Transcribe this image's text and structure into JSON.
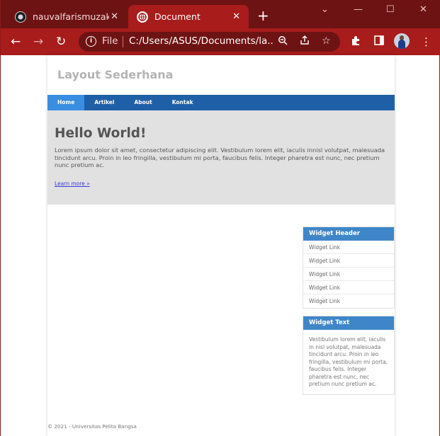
{
  "browser": {
    "tabs": [
      {
        "title": "nauvalfarismuzaki/la",
        "active": false,
        "favicon": "github-icon"
      },
      {
        "title": "Document",
        "active": true,
        "favicon": "globe-icon"
      }
    ],
    "new_tab_symbol": "+",
    "window_controls": {
      "minimize": "—",
      "maximize": "☐",
      "close": "✕",
      "tab_search": "⌄"
    },
    "address_bar": {
      "scheme": "File",
      "url": "C:/Users/ASUS/Documents/la..."
    },
    "theme_color": "#a81c1c"
  },
  "page": {
    "site_title": "Layout Sederhana",
    "nav": [
      {
        "label": "Home",
        "active": true
      },
      {
        "label": "Artikel",
        "active": false
      },
      {
        "label": "About",
        "active": false
      },
      {
        "label": "Kontak",
        "active": false
      }
    ],
    "hero": {
      "heading": "Hello World!",
      "body": "Lorem ipsum dolor sit amet, consectetur adipiscing elit. Vestibulum lorem elit, iaculis innisl volutpat, malesuada tincidunt arcu. Proin in leo fringilla, vestibulum mi porta, faucibus felis. Integer pharetra est nunc, nec pretium nunc pretium ac.",
      "link": "Learn more »"
    },
    "widget_links": {
      "header": "Widget Header",
      "links": [
        "Widget Link",
        "Widget Link",
        "Widget Link",
        "Widget Link",
        "Widget Link"
      ]
    },
    "widget_text": {
      "header": "Widget Text",
      "body": "Vestibulum lorem elit, iaculis in nisl volutpat, malesuada tincidunt arcu. Proin in leo fringilla, vestibulum mi porta, faucibus felis. Integer pharetra est nunc, nec pretium nunc pretium ac."
    },
    "footer": "© 2021 - Universitas Pelita Bangsa",
    "colors": {
      "nav": "#1f5fa8",
      "nav_active": "#3a8ee0",
      "widget_header": "#3f86c9",
      "hero_bg": "#e1e1e1"
    }
  }
}
